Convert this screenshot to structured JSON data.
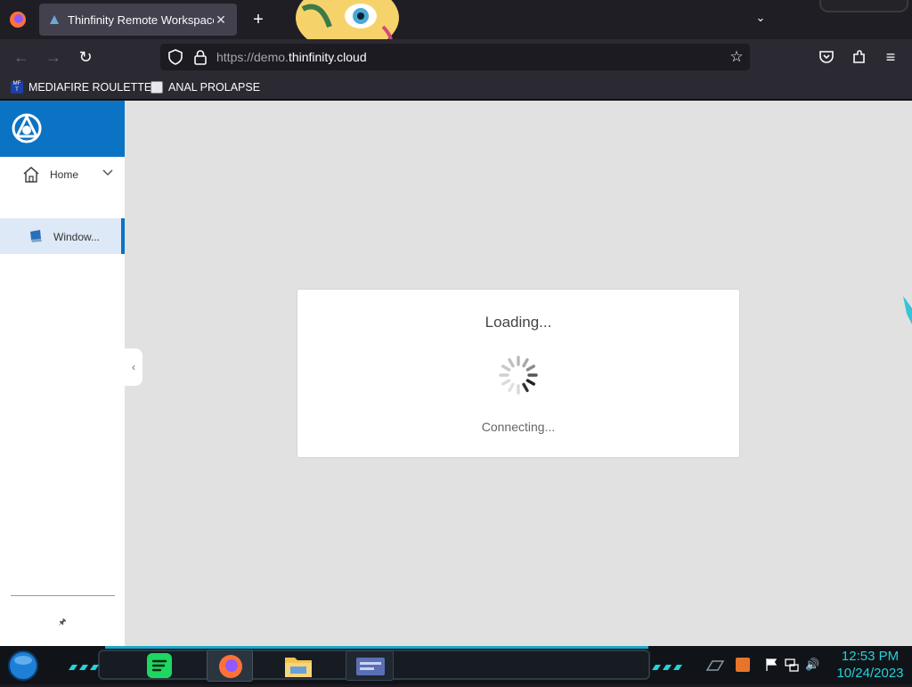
{
  "browser": {
    "tab_title": "Thinfinity Remote Workspace",
    "url_prefix": "https://demo.",
    "url_domain": "thinfinity.cloud",
    "bookmarks": [
      {
        "label": "MEDIAFIRE ROULETTER",
        "icon": "mediafire-icon"
      },
      {
        "label": "ANAL PROLAPSE",
        "icon": "terminal-icon"
      }
    ]
  },
  "app": {
    "nav": {
      "home_label": "Home",
      "windows_label": "Window..."
    },
    "dialog": {
      "title": "Loading...",
      "status": "Connecting..."
    }
  },
  "taskbar": {
    "time": "12:53 PM",
    "date": "10/24/2023"
  },
  "colors": {
    "brand_blue": "#0b73c4",
    "tray_cyan": "#24d2d9",
    "main_bg": "#e1e1e1"
  }
}
